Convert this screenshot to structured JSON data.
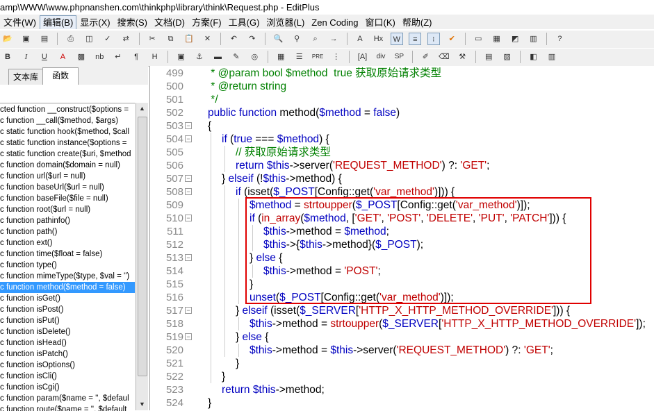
{
  "window": {
    "title": "amp\\WWW\\www.phpnanshen.com\\thinkphp\\library\\think\\Request.php - EditPlus"
  },
  "menu": [
    "文件(W)",
    "编辑(B)",
    "显示(X)",
    "搜索(S)",
    "文档(D)",
    "方案(F)",
    "工具(G)",
    "浏览器(L)",
    "Zen Coding",
    "窗口(K)",
    "帮助(Z)"
  ],
  "sidebar": {
    "tabs": [
      "文本库",
      "函数"
    ],
    "functions": [
      "cted function __construct($options =",
      "c function __call($method, $args)",
      "c static function hook($method, $call",
      "c static function instance($options =",
      "c static function create($uri, $method",
      "c function domain($domain = null)",
      "c function url($url = null)",
      "c function baseUrl($url = null)",
      "c function baseFile($file = null)",
      "c function root($url = null)",
      "c function pathinfo()",
      "c function path()",
      "c function ext()",
      "c function time($float = false)",
      "c function type()",
      "c function mimeType($type, $val = '')",
      "c function method($method = false)",
      "c function isGet()",
      "c function isPost()",
      "c function isPut()",
      "c function isDelete()",
      "c function isHead()",
      "c function isPatch()",
      "c function isOptions()",
      "c function isCli()",
      "c function isCgi()",
      "c function param($name = '', $defaul",
      "c function route($name = '', $default"
    ],
    "selected_index": 16
  },
  "editor": {
    "lines": [
      {
        "n": "499",
        "fold": false,
        "indent": 0
      },
      {
        "n": "500",
        "fold": false,
        "indent": 0
      },
      {
        "n": "501",
        "fold": false,
        "indent": 0
      },
      {
        "n": "502",
        "fold": false,
        "indent": 0
      },
      {
        "n": "503",
        "fold": true,
        "indent": 0
      },
      {
        "n": "504",
        "fold": true,
        "indent": 1
      },
      {
        "n": "505",
        "fold": false,
        "indent": 2
      },
      {
        "n": "506",
        "fold": false,
        "indent": 2
      },
      {
        "n": "507",
        "fold": true,
        "indent": 1
      },
      {
        "n": "508",
        "fold": true,
        "indent": 2
      },
      {
        "n": "509",
        "fold": false,
        "indent": 3
      },
      {
        "n": "510",
        "fold": true,
        "indent": 3
      },
      {
        "n": "511",
        "fold": false,
        "indent": 4
      },
      {
        "n": "512",
        "fold": false,
        "indent": 4
      },
      {
        "n": "513",
        "fold": true,
        "indent": 3
      },
      {
        "n": "514",
        "fold": false,
        "indent": 4
      },
      {
        "n": "515",
        "fold": false,
        "indent": 3
      },
      {
        "n": "516",
        "fold": false,
        "indent": 3
      },
      {
        "n": "517",
        "fold": true,
        "indent": 2
      },
      {
        "n": "518",
        "fold": false,
        "indent": 3
      },
      {
        "n": "519",
        "fold": true,
        "indent": 2
      },
      {
        "n": "520",
        "fold": false,
        "indent": 3
      },
      {
        "n": "521",
        "fold": false,
        "indent": 2
      },
      {
        "n": "522",
        "fold": false,
        "indent": 1
      },
      {
        "n": "523",
        "fold": false,
        "indent": 1
      },
      {
        "n": "524",
        "fold": false,
        "indent": 0
      }
    ],
    "code": [
      [
        [
          "cm",
          " * @param bool $method  true 获取原始请求类型"
        ]
      ],
      [
        [
          "cm",
          " * @return string"
        ]
      ],
      [
        [
          "cm",
          " */"
        ]
      ],
      [
        [
          "kw",
          "public function "
        ],
        [
          "",
          "method("
        ],
        [
          "va",
          "$method"
        ],
        [
          "",
          " = "
        ],
        [
          "kw",
          "false"
        ],
        [
          "",
          ")"
        ]
      ],
      [
        [
          "",
          "{"
        ]
      ],
      [
        [
          "kw",
          "if "
        ],
        [
          "",
          "("
        ],
        [
          "kw",
          "true"
        ],
        [
          "",
          " === "
        ],
        [
          "va",
          "$method"
        ],
        [
          "",
          ") {"
        ]
      ],
      [
        [
          "cm",
          "// 获取原始请求类型"
        ]
      ],
      [
        [
          "kw",
          "return "
        ],
        [
          "va",
          "$this"
        ],
        [
          "",
          "->server("
        ],
        [
          "str",
          "'REQUEST_METHOD'"
        ],
        [
          "",
          ") ?: "
        ],
        [
          "str",
          "'GET'"
        ],
        [
          "",
          ";"
        ]
      ],
      [
        [
          "",
          "} "
        ],
        [
          "kw",
          "elseif "
        ],
        [
          "",
          "(!"
        ],
        [
          "va",
          "$this"
        ],
        [
          "",
          "->method) {"
        ]
      ],
      [
        [
          "kw",
          "if "
        ],
        [
          "",
          "(isset("
        ],
        [
          "va",
          "$_POST"
        ],
        [
          "",
          "[Config::get("
        ],
        [
          "str",
          "'var_method'"
        ],
        [
          "",
          ")])) {"
        ]
      ],
      [
        [
          "va",
          "$method"
        ],
        [
          "",
          " = "
        ],
        [
          "fnc",
          "strtoupper"
        ],
        [
          "",
          "("
        ],
        [
          "va",
          "$_POST"
        ],
        [
          "",
          "[Config::get("
        ],
        [
          "str",
          "'var_method'"
        ],
        [
          "",
          ")]);"
        ]
      ],
      [
        [
          "kw",
          "if "
        ],
        [
          "",
          "("
        ],
        [
          "fnc",
          "in_array"
        ],
        [
          "",
          "("
        ],
        [
          "va",
          "$method"
        ],
        [
          "",
          ", ["
        ],
        [
          "str",
          "'GET'"
        ],
        [
          "",
          ", "
        ],
        [
          "str",
          "'POST'"
        ],
        [
          "",
          ", "
        ],
        [
          "str",
          "'DELETE'"
        ],
        [
          "",
          ", "
        ],
        [
          "str",
          "'PUT'"
        ],
        [
          "",
          ", "
        ],
        [
          "str",
          "'PATCH'"
        ],
        [
          "",
          "])) {"
        ]
      ],
      [
        [
          "va",
          "$this"
        ],
        [
          "",
          "->method = "
        ],
        [
          "va",
          "$method"
        ],
        [
          "",
          ";"
        ]
      ],
      [
        [
          "va",
          "$this"
        ],
        [
          "",
          "->{"
        ],
        [
          "va",
          "$this"
        ],
        [
          "",
          "->method}("
        ],
        [
          "va",
          "$_POST"
        ],
        [
          "",
          ");"
        ]
      ],
      [
        [
          "",
          "} "
        ],
        [
          "kw",
          "else "
        ],
        [
          "",
          "{"
        ]
      ],
      [
        [
          "va",
          "$this"
        ],
        [
          "",
          "->method = "
        ],
        [
          "str",
          "'POST'"
        ],
        [
          "",
          ";"
        ]
      ],
      [
        [
          "",
          "}"
        ]
      ],
      [
        [
          "kw",
          "unset"
        ],
        [
          "",
          "("
        ],
        [
          "va",
          "$_POST"
        ],
        [
          "",
          "[Config::get("
        ],
        [
          "str",
          "'var_method'"
        ],
        [
          "",
          ")]);"
        ]
      ],
      [
        [
          "",
          "} "
        ],
        [
          "kw",
          "elseif "
        ],
        [
          "",
          "(isset("
        ],
        [
          "va",
          "$_SERVER"
        ],
        [
          "",
          "["
        ],
        [
          "str",
          "'HTTP_X_HTTP_METHOD_OVERRIDE'"
        ],
        [
          "",
          "])) {"
        ]
      ],
      [
        [
          "va",
          "$this"
        ],
        [
          "",
          "->method = "
        ],
        [
          "fnc",
          "strtoupper"
        ],
        [
          "",
          "("
        ],
        [
          "va",
          "$_SERVER"
        ],
        [
          "",
          "["
        ],
        [
          "str",
          "'HTTP_X_HTTP_METHOD_OVERRIDE'"
        ],
        [
          "",
          "]);"
        ]
      ],
      [
        [
          "",
          "} "
        ],
        [
          "kw",
          "else "
        ],
        [
          "",
          "{"
        ]
      ],
      [
        [
          "va",
          "$this"
        ],
        [
          "",
          "->method = "
        ],
        [
          "va",
          "$this"
        ],
        [
          "",
          "->server("
        ],
        [
          "str",
          "'REQUEST_METHOD'"
        ],
        [
          "",
          ") ?: "
        ],
        [
          "str",
          "'GET'"
        ],
        [
          "",
          ";"
        ]
      ],
      [
        [
          "",
          "}"
        ]
      ],
      [
        [
          "",
          "}"
        ]
      ],
      [
        [
          "kw",
          "return "
        ],
        [
          "va",
          "$this"
        ],
        [
          "",
          "->method;"
        ]
      ],
      [
        [
          "",
          "}"
        ]
      ]
    ]
  },
  "colors": {
    "selection": "#3399ff",
    "highlight_box": "#e00000",
    "keyword": "#0000c0",
    "string": "#c00000",
    "comment": "#008000"
  }
}
